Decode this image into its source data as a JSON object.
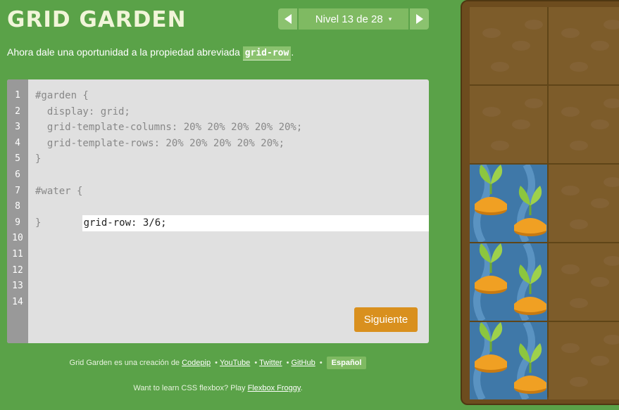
{
  "header": {
    "title": "GRID GARDEN",
    "level_label": "Nivel 13 de 28",
    "level_caret": "▾"
  },
  "instructions": {
    "text_before": "Ahora dale una oportunidad a la propiedad abreviada ",
    "code": "grid-row",
    "text_after": "."
  },
  "editor": {
    "line_numbers": [
      "1",
      "2",
      "3",
      "4",
      "5",
      "6",
      "7",
      "8",
      "9",
      "10",
      "11",
      "12",
      "13",
      "14"
    ],
    "lines": [
      "#garden {",
      "  display: grid;",
      "  grid-template-columns: 20% 20% 20% 20% 20%;",
      "  grid-template-rows: 20% 20% 20% 20% 20%;",
      "}",
      "",
      "#water {"
    ],
    "input_value": "grid-row: 3/6;",
    "closing_line": "}",
    "next_button": "Siguiente"
  },
  "footer": {
    "credit_prefix": "Grid Garden es una creación de ",
    "links": [
      "Codepip",
      "YouTube",
      "Twitter",
      "GitHub"
    ],
    "separator": "•",
    "language_button": "Español",
    "flexbox_text": "Want to learn CSS flexbox? Play ",
    "flexbox_link": "Flexbox Froggy",
    "flexbox_after": "."
  },
  "colors": {
    "background": "#5aa248",
    "soil": "#7d5c2a",
    "water": "#3f78a8",
    "carrot": "#f0a023",
    "leaf": "#8cc63f",
    "button": "#d9901e"
  }
}
